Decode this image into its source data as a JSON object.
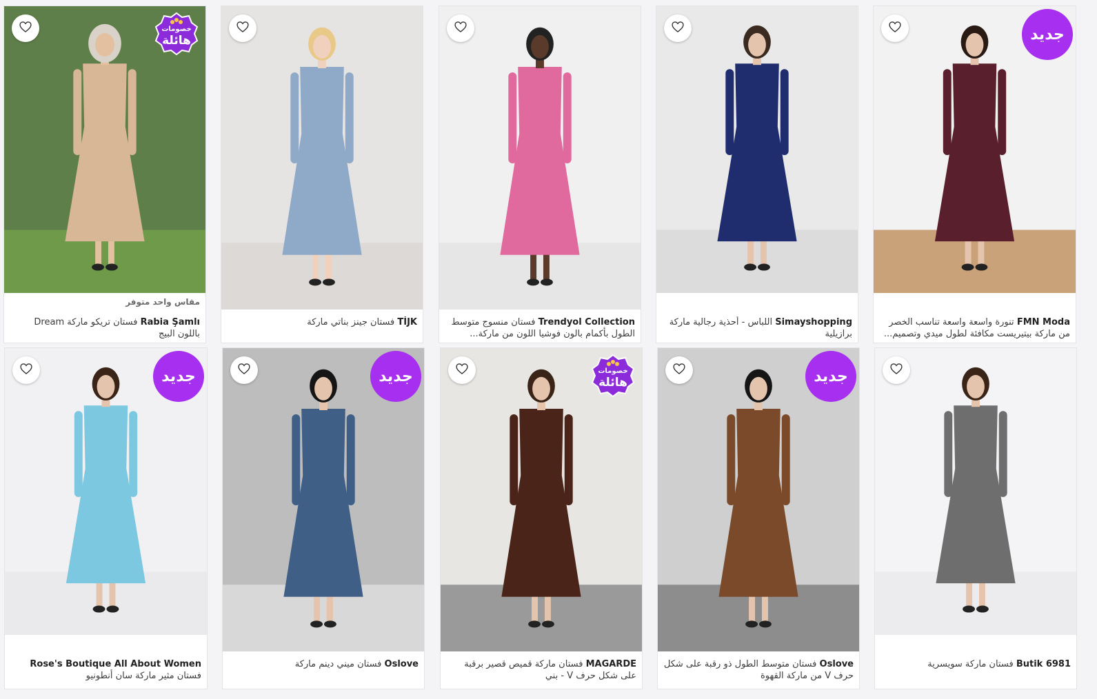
{
  "colors": {
    "badge_purple": "#a72ff0",
    "sale_purple": "#8b2bd9",
    "star_gold": "#f6c54a"
  },
  "badges": {
    "new_label": "جديد",
    "sale_top": "خصومات",
    "sale_bottom": "هائلة"
  },
  "products": [
    {
      "brand": "Rabia Şamlı",
      "title": "فستان تريكو ماركة Dream باللون البيج",
      "note": "مقاس واحد متوفر",
      "badge": "sale",
      "favorite_icon": "heart-outline-icon",
      "photo": {
        "bg": "#5f7f4a",
        "floor": "#6f9a4a",
        "dress": "#d8b797",
        "skin": "#e2c0a0",
        "hair": "#d9d2c8",
        "hijab": true
      }
    },
    {
      "brand": "TİJK",
      "title": "فستان جينز بناتي ماركة",
      "note": "",
      "badge": "",
      "favorite_icon": "heart-outline-icon",
      "photo": {
        "bg": "#e6e4e2",
        "floor": "#dcd9d6",
        "dress": "#8fa9c8",
        "skin": "#f0d1bd",
        "hair": "#e8c987",
        "hijab": false
      }
    },
    {
      "brand": "Trendyol Collection",
      "title": "فستان منسوج متوسط الطول بأكمام بالون فوشيا اللون من ماركة...",
      "note": "",
      "badge": "",
      "favorite_icon": "heart-outline-icon",
      "photo": {
        "bg": "#f0f0f0",
        "floor": "#e6e6e6",
        "dress": "#e06a9d",
        "skin": "#5a3a2a",
        "hair": "#222222",
        "hijab": false
      }
    },
    {
      "brand": "Simayshopping",
      "title": "اللباس - أحذية رجالية ماركة برازيلية",
      "note": "",
      "badge": "",
      "favorite_icon": "heart-outline-icon",
      "photo": {
        "bg": "#e9e9e9",
        "floor": "#dcdcdc",
        "dress": "#1f2d6e",
        "skin": "#e5c4ad",
        "hair": "#3a2a20",
        "hijab": false
      }
    },
    {
      "brand": "FMN Moda",
      "title": "تنورة واسعة واسعة تناسب الخصر من ماركة بيتيريست مكافئة لطول ميدي وتصميم...",
      "note": "",
      "badge": "new",
      "favorite_icon": "heart-outline-icon",
      "photo": {
        "bg": "#f2f2f2",
        "floor": "#caa27a",
        "dress": "#5a1f2c",
        "skin": "#e5c4ad",
        "hair": "#2a1a14",
        "hijab": false
      }
    },
    {
      "brand": "Rose's Boutique All About Women",
      "title": "فستان مثير ماركة سان أنطونيو",
      "note": "",
      "badge": "new",
      "favorite_icon": "heart-outline-icon",
      "photo": {
        "bg": "#f1f1f3",
        "floor": "#eaeaec",
        "dress": "#7cc8e0",
        "skin": "#e5c4ad",
        "hair": "#3a2418",
        "hijab": false
      }
    },
    {
      "brand": "Oslove",
      "title": "فستان ميني دينم ماركة",
      "note": "",
      "badge": "new",
      "favorite_icon": "heart-outline-icon",
      "photo": {
        "bg": "#bdbdbd",
        "floor": "#d8d8d8",
        "dress": "#3f5f86",
        "skin": "#e5c4ad",
        "hair": "#151515",
        "hijab": false
      }
    },
    {
      "brand": "MAGARDE",
      "title": "فستان ماركة قميص قصير برقبة على شكل حرف V - بني",
      "note": "",
      "badge": "sale",
      "favorite_icon": "heart-outline-icon",
      "photo": {
        "bg": "#e8e6e2",
        "floor": "#9a9a9a",
        "dress": "#4a2418",
        "skin": "#e5c4ad",
        "hair": "#3a2418",
        "hijab": false
      }
    },
    {
      "brand": "Oslove",
      "title": "فستان متوسط الطول ذو رقبة على شكل حرف V من ماركة القهوة",
      "note": "",
      "badge": "new",
      "favorite_icon": "heart-outline-icon",
      "photo": {
        "bg": "#cfcfcf",
        "floor": "#8d8d8d",
        "dress": "#7a4a2a",
        "skin": "#e5c4ad",
        "hair": "#151515",
        "hijab": false
      }
    },
    {
      "brand": "Butik 6981",
      "title": "فستان ماركة سويسرية",
      "note": "",
      "badge": "",
      "favorite_icon": "heart-outline-icon",
      "photo": {
        "bg": "#f4f4f6",
        "floor": "#ececee",
        "dress": "#6e6e6e",
        "skin": "#e5c4ad",
        "hair": "#3a2418",
        "hijab": false
      }
    }
  ]
}
